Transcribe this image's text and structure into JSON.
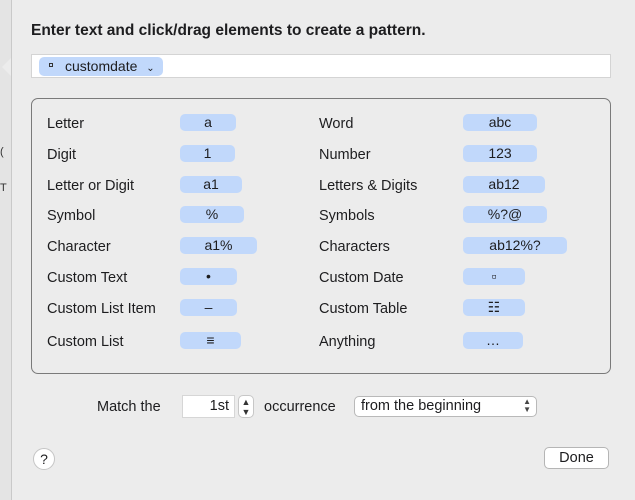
{
  "dialog": {
    "heading": "Enter text and click/drag elements to create a pattern.",
    "pattern_token": {
      "label": "customdate",
      "icon": "square-icon",
      "chevron": "⌄"
    }
  },
  "palette": {
    "left": [
      {
        "label": "Letter",
        "token": "a"
      },
      {
        "label": "Digit",
        "token": "1"
      },
      {
        "label": "Letter or Digit",
        "token": "a1"
      },
      {
        "label": "Symbol",
        "token": "%"
      },
      {
        "label": "Character",
        "token": "a1%"
      },
      {
        "label": "Custom Text",
        "token": "•"
      },
      {
        "label": "Custom List Item",
        "token": "–"
      },
      {
        "label": "Custom List",
        "token": "≡"
      }
    ],
    "right": [
      {
        "label": "Word",
        "token": "abc"
      },
      {
        "label": "Number",
        "token": "123"
      },
      {
        "label": "Letters & Digits",
        "token": "ab12"
      },
      {
        "label": "Symbols",
        "token": "%?@"
      },
      {
        "label": "Characters",
        "token": "ab12%?"
      },
      {
        "label": "Custom Date",
        "token": "▫"
      },
      {
        "label": "Custom Table",
        "token": "☷"
      },
      {
        "label": "Anything",
        "token": "…"
      }
    ]
  },
  "match": {
    "prefix": "Match the",
    "occurrence_value": "1st",
    "middle": "occurrence",
    "position_selected": "from the beginning"
  },
  "footer": {
    "help_label": "?",
    "done_label": "Done"
  },
  "background": {
    "fragments": [
      "(",
      "T"
    ]
  },
  "colors": {
    "token_bg": "#c1d8fb",
    "sheet_bg": "#ececec"
  }
}
